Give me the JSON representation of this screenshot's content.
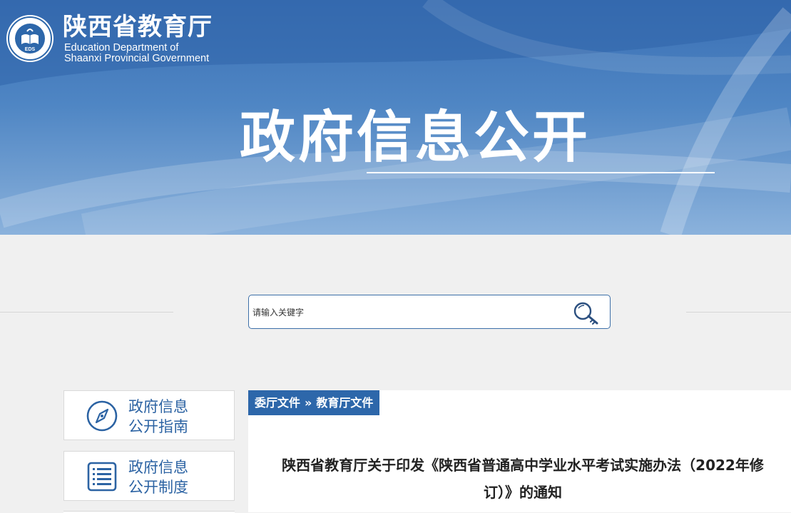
{
  "header": {
    "site_name": "陕西省教育厅",
    "site_name_en_line1": "Education Department of",
    "site_name_en_line2": "Shaanxi Provincial Government",
    "logo_text": "EDS",
    "banner_title": "政府信息公开"
  },
  "search": {
    "placeholder": "请输入关键字",
    "icon": "search-key-icon"
  },
  "sidebar": {
    "items": [
      {
        "line1": "政府信息",
        "line2": "公开指南",
        "icon": "compass-icon"
      },
      {
        "line1": "政府信息",
        "line2": "公开制度",
        "icon": "list-document-icon"
      }
    ]
  },
  "breadcrumb": {
    "items": [
      "委厅文件",
      "教育厅文件"
    ],
    "separator": "»"
  },
  "document": {
    "title_line1": "陕西省教育厅关于印发《陕西省普通高中学业水平考试实施办法（2022年修",
    "title_line2": "订）》的通知"
  },
  "colors": {
    "brand_blue": "#2d67aa",
    "banner_blue": "#3a6fb4",
    "page_bg": "#f0f0f0"
  }
}
